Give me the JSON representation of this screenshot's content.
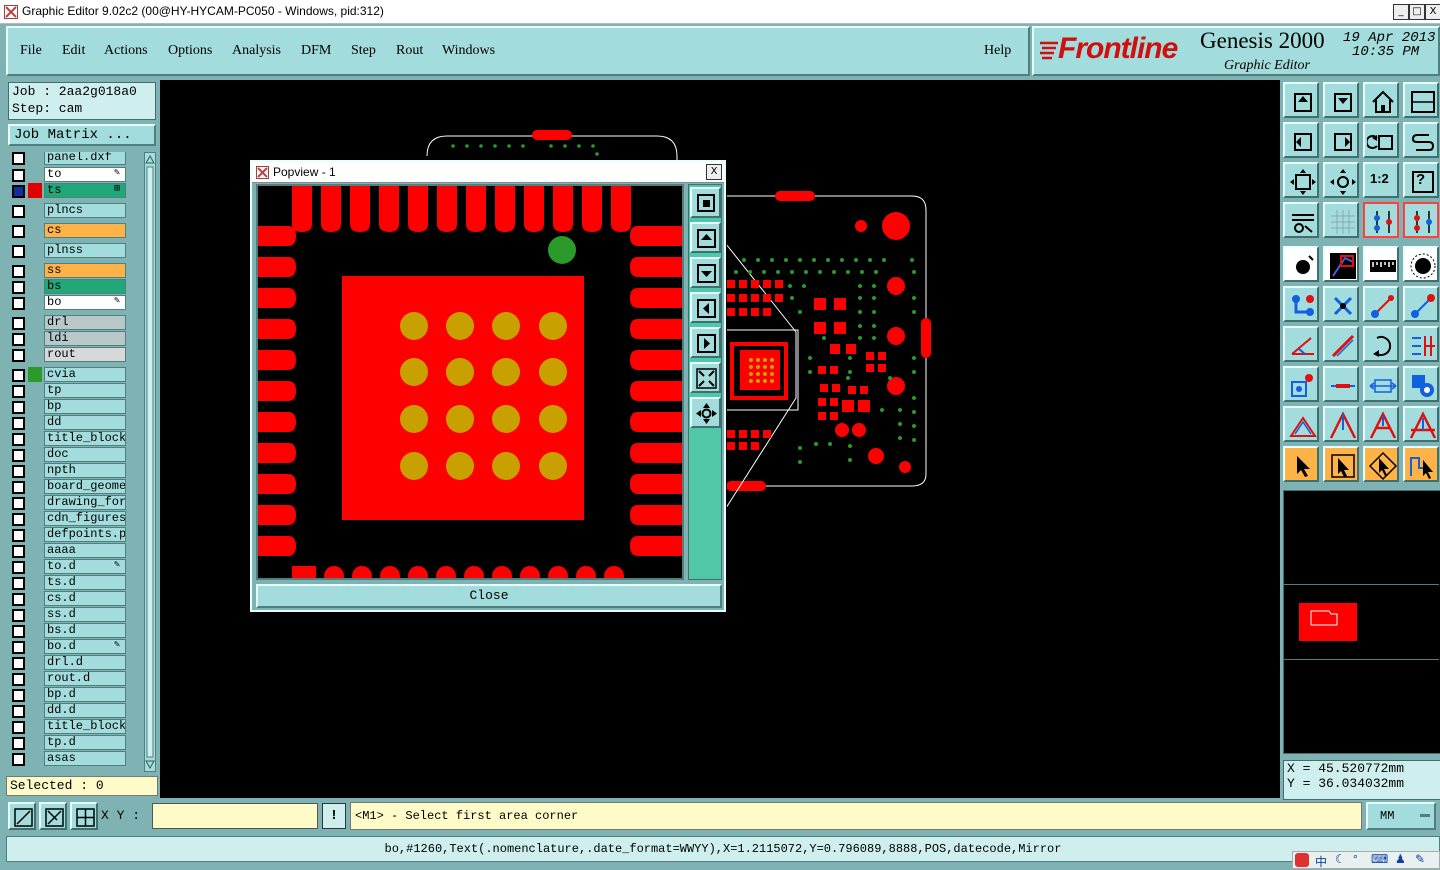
{
  "window": {
    "title": "Graphic Editor 9.02c2 (00@HY-HYCAM-PC050 - Windows, pid:312)",
    "min_label": "_",
    "max_label": "□",
    "close_label": "X"
  },
  "menu": {
    "items": [
      "File",
      "Edit",
      "Actions",
      "Options",
      "Analysis",
      "DFM",
      "Step",
      "Rout",
      "Windows"
    ],
    "help": "Help"
  },
  "brand": {
    "logo": "Frontline",
    "product": "Genesis 2000",
    "subtitle": "Graphic Editor",
    "date": "19 Apr 2013",
    "time": "10:35 PM"
  },
  "job": {
    "job_label": "Job : 2aa2g018a0",
    "step_label": "Step: cam",
    "matrix_button": "Job Matrix ..."
  },
  "layers": [
    {
      "name": "panel.dxf",
      "swatch": "",
      "box": "#a3dcdc",
      "mark": ""
    },
    {
      "name": "to",
      "swatch": "",
      "box": "#ffffff",
      "mark": "✎"
    },
    {
      "name": "ts",
      "swatch": "#e00000",
      "box": "#20a878",
      "mark": "⊞",
      "active": true
    },
    {
      "name": "plncs",
      "swatch": "",
      "box": "#a3dcdc",
      "mark": ""
    },
    {
      "name": "cs",
      "swatch": "",
      "box": "#ffb347",
      "mark": ""
    },
    {
      "name": "plnss",
      "swatch": "",
      "box": "#a3dcdc",
      "mark": ""
    },
    {
      "name": "ss",
      "swatch": "",
      "box": "#ffb347",
      "mark": ""
    },
    {
      "name": "bs",
      "swatch": "",
      "box": "#20a878",
      "mark": ""
    },
    {
      "name": "bo",
      "swatch": "",
      "box": "#ffffff",
      "mark": "✎"
    },
    {
      "name": "drl",
      "swatch": "",
      "box": "#b8c8c8",
      "mark": ""
    },
    {
      "name": "ldi",
      "swatch": "",
      "box": "#b8c8c8",
      "mark": ""
    },
    {
      "name": "rout",
      "swatch": "",
      "box": "#d8d8d8",
      "mark": ""
    },
    {
      "name": "cvia",
      "swatch": "#2a9a2a",
      "box": "#a3dcdc",
      "mark": ""
    },
    {
      "name": "tp",
      "swatch": "",
      "box": "#a3dcdc",
      "mark": ""
    },
    {
      "name": "bp",
      "swatch": "",
      "box": "#a3dcdc",
      "mark": ""
    },
    {
      "name": "dd",
      "swatch": "",
      "box": "#a3dcdc",
      "mark": ""
    },
    {
      "name": "title_block",
      "swatch": "",
      "box": "#a3dcdc",
      "mark": ""
    },
    {
      "name": "doc",
      "swatch": "",
      "box": "#a3dcdc",
      "mark": ""
    },
    {
      "name": "npth",
      "swatch": "",
      "box": "#a3dcdc",
      "mark": ""
    },
    {
      "name": "board_geomet",
      "swatch": "",
      "box": "#a3dcdc",
      "mark": ""
    },
    {
      "name": "drawing_forn",
      "swatch": "",
      "box": "#a3dcdc",
      "mark": ""
    },
    {
      "name": "cdn_figures",
      "swatch": "",
      "box": "#a3dcdc",
      "mark": ""
    },
    {
      "name": "defpoints.pa",
      "swatch": "",
      "box": "#a3dcdc",
      "mark": ""
    },
    {
      "name": "aaaa",
      "swatch": "",
      "box": "#a3dcdc",
      "mark": ""
    },
    {
      "name": "to.d",
      "swatch": "",
      "box": "#a3dcdc",
      "mark": "✎"
    },
    {
      "name": "ts.d",
      "swatch": "",
      "box": "#a3dcdc",
      "mark": ""
    },
    {
      "name": "cs.d",
      "swatch": "",
      "box": "#a3dcdc",
      "mark": ""
    },
    {
      "name": "ss.d",
      "swatch": "",
      "box": "#a3dcdc",
      "mark": ""
    },
    {
      "name": "bs.d",
      "swatch": "",
      "box": "#a3dcdc",
      "mark": ""
    },
    {
      "name": "bo.d",
      "swatch": "",
      "box": "#a3dcdc",
      "mark": "✎"
    },
    {
      "name": "drl.d",
      "swatch": "",
      "box": "#a3dcdc",
      "mark": ""
    },
    {
      "name": "rout.d",
      "swatch": "",
      "box": "#a3dcdc",
      "mark": ""
    },
    {
      "name": "bp.d",
      "swatch": "",
      "box": "#a3dcdc",
      "mark": ""
    },
    {
      "name": "dd.d",
      "swatch": "",
      "box": "#a3dcdc",
      "mark": ""
    },
    {
      "name": "title_block",
      "swatch": "",
      "box": "#a3dcdc",
      "mark": ""
    },
    {
      "name": "tp.d",
      "swatch": "",
      "box": "#a3dcdc",
      "mark": ""
    },
    {
      "name": "asas",
      "swatch": "",
      "box": "#a3dcdc",
      "mark": ""
    }
  ],
  "selected": "Selected : 0",
  "popview": {
    "title": "Popview - 1",
    "close_x": "X",
    "close_button": "Close",
    "tool_icons": [
      "zoom-box-icon",
      "pan-up-icon",
      "pan-down-icon",
      "pan-left-icon",
      "pan-right-icon",
      "zoom-fit-icon",
      "zoom-home-icon"
    ]
  },
  "toolbar": {
    "one_to_two": "1:2",
    "question": "?"
  },
  "coords": {
    "x": "X = 45.520772mm",
    "y": "Y = 36.034032mm"
  },
  "bottom": {
    "xy_label": "X Y :",
    "xy_value": "",
    "info_button": "!",
    "prompt": "<M1> - Select first area corner",
    "units": "MM"
  },
  "status": {
    "text": "bo,#1260,Text(.nomenclature,.date_format=WWYY),X=1.2115072,Y=0.796089,8888,POS,datecode,Mirror"
  },
  "tray": {
    "ime": "中"
  },
  "colors": {
    "pad_red": "#ff0000",
    "via_green": "#2a9a2a",
    "gold": "#c8a000",
    "panel_teal": "#a3dcdc"
  }
}
